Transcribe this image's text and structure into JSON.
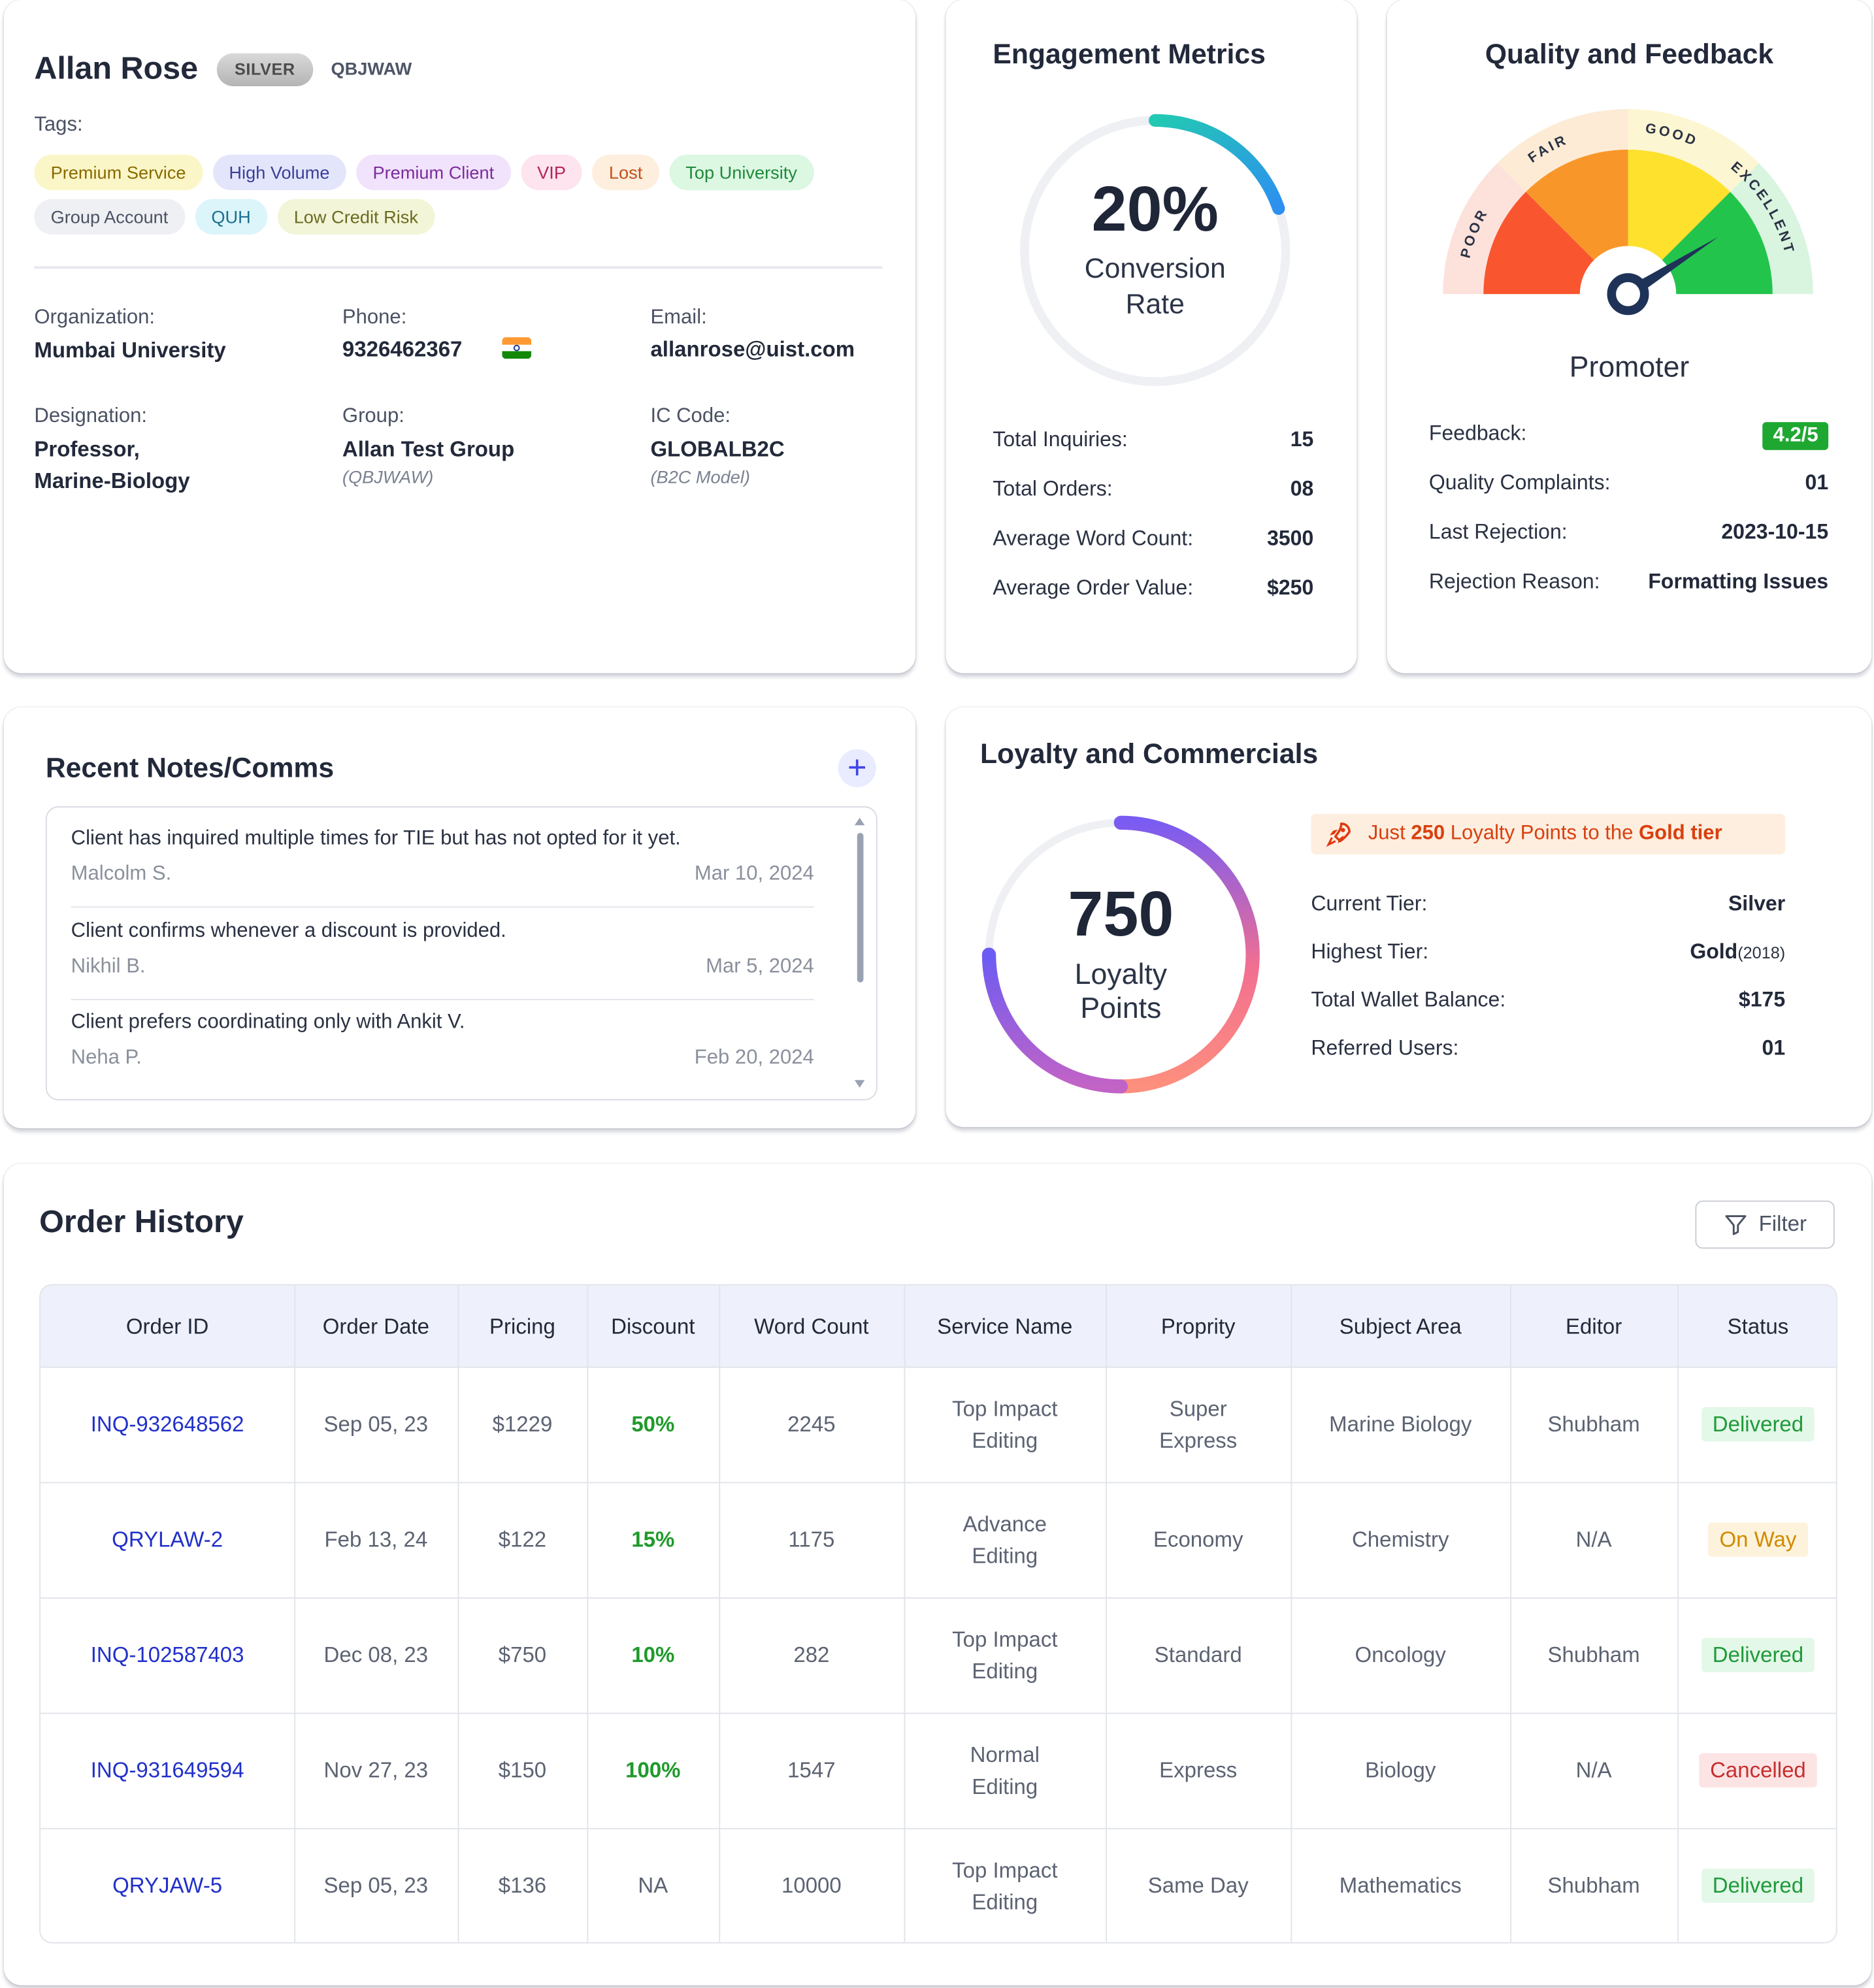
{
  "profile": {
    "name": "Allan Rose",
    "tier_badge": "SILVER",
    "code": "QBJWAW",
    "tags_label": "Tags:",
    "tags": [
      {
        "label": "Premium Service",
        "bg": "#fbf6c7",
        "fg": "#8a6a00"
      },
      {
        "label": "High Volume",
        "bg": "#e3e6fb",
        "fg": "#3b3f98"
      },
      {
        "label": "Premium Client",
        "bg": "#f1e3fb",
        "fg": "#7b2c9c"
      },
      {
        "label": "VIP",
        "bg": "#fde4ef",
        "fg": "#b3245c"
      },
      {
        "label": "Lost",
        "bg": "#fdeede",
        "fg": "#c5501a"
      },
      {
        "label": "Top University",
        "bg": "#dcf7e2",
        "fg": "#1f8a3a"
      },
      {
        "label": "Group Account",
        "bg": "#eef0f3",
        "fg": "#4a5263"
      },
      {
        "label": "QUH",
        "bg": "#dbf5fb",
        "fg": "#1f6f8e"
      },
      {
        "label": "Low Credit Risk",
        "bg": "#f3f5d8",
        "fg": "#6a6b22"
      }
    ],
    "organization_label": "Organization:",
    "organization": "Mumbai University",
    "phone_label": "Phone:",
    "phone": "9326462367",
    "email_label": "Email:",
    "email": "allanrose@uist.com",
    "designation_label": "Designation:",
    "designation_line1": "Professor,",
    "designation_line2": "Marine-Biology",
    "group_label": "Group:",
    "group": "Allan Test Group",
    "group_sub": "(QBJWAW)",
    "ic_label": "IC Code:",
    "ic": "GLOBALB2C",
    "ic_sub": "(B2C Model)",
    "flag_icon": "india-flag-icon"
  },
  "engagement": {
    "title": "Engagement Metrics",
    "conversion_value": "20%",
    "conversion_label_1": "Conversion",
    "conversion_label_2": "Rate",
    "conversion_fraction": 0.2,
    "rows": [
      {
        "label": "Total Inquiries:",
        "value": "15"
      },
      {
        "label": "Total Orders:",
        "value": "08"
      },
      {
        "label": "Average Word Count:",
        "value": "3500"
      },
      {
        "label": "Average Order Value:",
        "value": "$250"
      }
    ]
  },
  "quality": {
    "title": "Quality and Feedback",
    "gauge_labels": [
      "POOR",
      "FAIR",
      "GOOD",
      "EXCELLENT"
    ],
    "gauge_colors": [
      "#f9552e",
      "#f9962a",
      "#fde12d",
      "#23c44c"
    ],
    "gauge_bands": [
      "#fde1db",
      "#fdebd6",
      "#fdf6d2",
      "#d9f4df"
    ],
    "gauge_needle_position": 0.82,
    "promoter": "Promoter",
    "feedback_label": "Feedback:",
    "feedback_value": "4.2/5",
    "complaints_label": "Quality Complaints:",
    "complaints_value": "01",
    "rejection_label": "Last Rejection:",
    "rejection_value": "2023-10-15",
    "reason_label": "Rejection Reason:",
    "reason_value": "Formatting Issues"
  },
  "notes": {
    "title": "Recent Notes/Comms",
    "add_icon": "plus-icon",
    "items": [
      {
        "text": "Client has inquired multiple times for TIE but has not opted for it yet.",
        "author": "Malcolm S.",
        "date": "Mar 10, 2024"
      },
      {
        "text": "Client confirms whenever a discount is provided.",
        "author": "Nikhil B.",
        "date": "Mar 5, 2024"
      },
      {
        "text": "Client prefers coordinating only with Ankit V.",
        "author": "Neha P.",
        "date": "Feb 20, 2024"
      }
    ]
  },
  "loyalty": {
    "title": "Loyalty and Commercials",
    "points": "750",
    "points_label_1": "Loyalty",
    "points_label_2": "Points",
    "points_fraction": 0.75,
    "banner_pre": "Just ",
    "banner_points": "250",
    "banner_mid": " Loyalty Points to the ",
    "banner_tier": "Gold tier",
    "banner_icon": "rocket-icon",
    "current_tier_label": "Current Tier:",
    "current_tier": "Silver",
    "highest_tier_label": "Highest Tier:",
    "highest_tier": "Gold",
    "highest_tier_year": "(2018)",
    "wallet_label": "Total Wallet Balance:",
    "wallet": "$175",
    "referred_label": "Referred Users:",
    "referred": "01"
  },
  "orders": {
    "title": "Order History",
    "filter_label": "Filter",
    "filter_icon": "funnel-icon",
    "columns": [
      "Order ID",
      "Order Date",
      "Pricing",
      "Discount",
      "Word Count",
      "Service Name",
      "Proprity",
      "Subject Area",
      "Editor",
      "Status"
    ],
    "rows": [
      {
        "id": "INQ-932648562",
        "date": "Sep 05, 23",
        "pricing": "$1229",
        "discount": "50%",
        "words": "2245",
        "service_1": "Top Impact",
        "service_2": "Editing",
        "priority_1": "Super",
        "priority_2": "Express",
        "subject": "Marine Biology",
        "editor": "Shubham",
        "status": "Delivered"
      },
      {
        "id": "QRYLAW-2",
        "date": "Feb 13, 24",
        "pricing": "$122",
        "discount": "15%",
        "words": "1175",
        "service_1": "Advance",
        "service_2": "Editing",
        "priority_1": "Economy",
        "priority_2": "",
        "subject": "Chemistry",
        "editor": "N/A",
        "status": "On Way"
      },
      {
        "id": "INQ-102587403",
        "date": "Dec 08, 23",
        "pricing": "$750",
        "discount": "10%",
        "words": "282",
        "service_1": "Top Impact",
        "service_2": "Editing",
        "priority_1": "Standard",
        "priority_2": "",
        "subject": "Oncology",
        "editor": "Shubham",
        "status": "Delivered"
      },
      {
        "id": "INQ-931649594",
        "date": "Nov 27, 23",
        "pricing": "$150",
        "discount": "100%",
        "words": "1547",
        "service_1": "Normal",
        "service_2": "Editing",
        "priority_1": "Express",
        "priority_2": "",
        "subject": "Biology",
        "editor": "N/A",
        "status": "Cancelled"
      },
      {
        "id": "QRYJAW-5",
        "date": "Sep 05, 23",
        "pricing": "$136",
        "discount": "NA",
        "words": "10000",
        "service_1": "Top Impact",
        "service_2": "Editing",
        "priority_1": "Same Day",
        "priority_2": "",
        "subject": "Mathematics",
        "editor": "Shubham",
        "status": "Delivered"
      }
    ],
    "status_colors": {
      "Delivered": {
        "bg": "#e3f8e8",
        "fg": "#1f9a3a"
      },
      "On Way": {
        "bg": "#fdf3dc",
        "fg": "#d08a00"
      },
      "Cancelled": {
        "bg": "#fde4e4",
        "fg": "#c62e2e"
      }
    }
  }
}
